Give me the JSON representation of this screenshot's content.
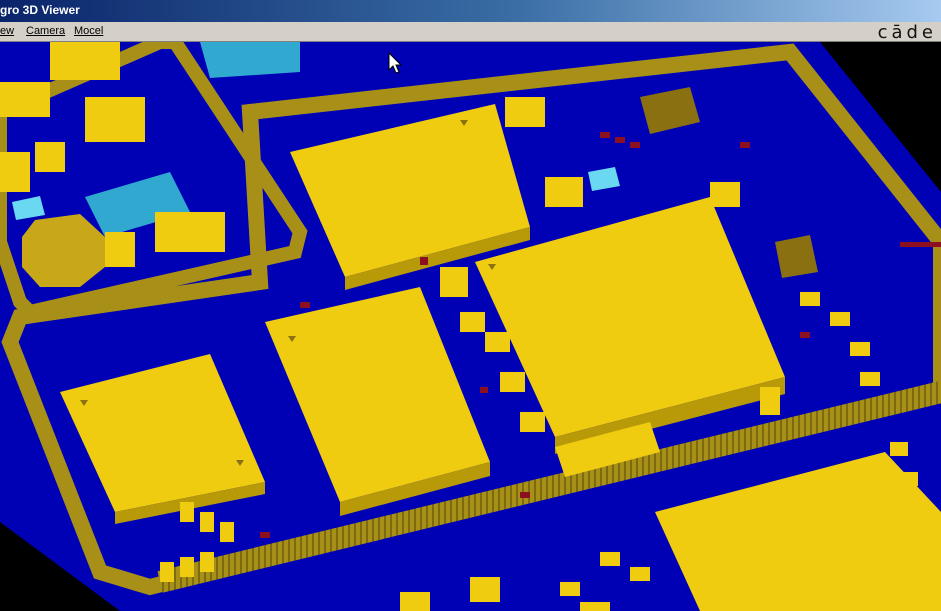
{
  "window": {
    "title": "gro 3D Viewer"
  },
  "menu": {
    "items": [
      "ew",
      "Camera",
      "Mocel"
    ]
  },
  "brand": {
    "logo_text": "cāde"
  },
  "colors": {
    "board_blue": "#0000b4",
    "component_yellow": "#f0cc10",
    "frame_olive": "#a89018",
    "chip_cyan": "#30a8d0",
    "pad_red": "#8c1020"
  }
}
